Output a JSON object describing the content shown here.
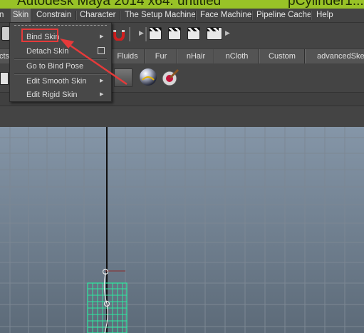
{
  "window": {
    "title": "Autodesk Maya 2014 x64: untitled",
    "title_right": "pCylinder1..."
  },
  "menubar": {
    "items": [
      {
        "label": "n"
      },
      {
        "label": "Skin"
      },
      {
        "label": "Constrain"
      },
      {
        "label": "Character"
      },
      {
        "label": "The Setup Machine"
      },
      {
        "label": "Face Machine"
      },
      {
        "label": "Pipeline Cache"
      },
      {
        "label": "Help"
      }
    ]
  },
  "shelf_tabs": [
    {
      "label": "cts"
    },
    {
      "label": "Fluids"
    },
    {
      "label": "Fur"
    },
    {
      "label": "nHair"
    },
    {
      "label": "nCloth"
    },
    {
      "label": "Custom"
    },
    {
      "label": "advancedSkel"
    }
  ],
  "skin_menu": {
    "items": [
      {
        "label": "Bind Skin",
        "submenu": true
      },
      {
        "label": "Detach Skin",
        "option_box": true
      },
      {
        "label": "Go to Bind Pose"
      },
      {
        "label": "Edit Smooth Skin",
        "submenu": true
      },
      {
        "label": "Edit Rigid Skin",
        "submenu": true
      }
    ]
  },
  "annotation": {
    "color": "#e53a3a"
  },
  "colors": {
    "title_bar": "#98c227",
    "viewport_top": "#8596a8",
    "viewport_bottom": "#5c6a78",
    "mesh": "#2ee8a0",
    "joint": "#000000"
  },
  "icons": [
    "magnet-icon",
    "clapper-icon",
    "render-sequence-icon",
    "ipr-render-icon",
    "render-settings-icon",
    "hypershade-sphere-icon",
    "paint-brush-icon",
    "shelf-cube-icon"
  ]
}
